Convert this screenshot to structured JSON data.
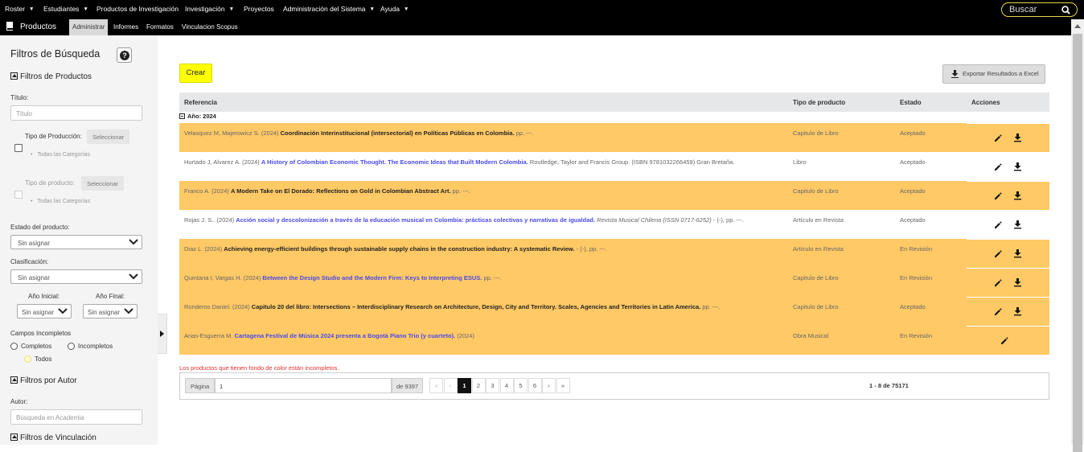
{
  "topnav": {
    "items": [
      {
        "label": "Roster",
        "caret": "▼"
      },
      {
        "label": "Estudiantes",
        "caret": "▼"
      },
      {
        "label": "Productos de Investigación",
        "caret": ""
      },
      {
        "label": "Investigación",
        "caret": "▼"
      },
      {
        "label": "Proyectos",
        "caret": ""
      },
      {
        "label": "Administración del Sistema",
        "caret": "▼"
      },
      {
        "label": "Ayuda",
        "caret": "▼"
      }
    ],
    "search_placeholder": "Buscar"
  },
  "subnav": {
    "brand": "Productos",
    "tabs": [
      "Administrar",
      "Informes",
      "Formatos",
      "Vinculacion Scopus"
    ]
  },
  "sidebar": {
    "title": "Filtros de Búsqueda",
    "help": "?",
    "section_productos": "Filtros de Productos",
    "titulo_label": "Título:",
    "titulo_placeholder": "Título",
    "tipo_produccion_label": "Tipo de Producción:",
    "tipo_produccion_btn": "Seleccionar",
    "tipo_produccion_all": "Todas las Categorías",
    "tipo_producto_label": "Tipo de producto:",
    "tipo_producto_btn": "Seleccionar",
    "tipo_producto_all": "Todas las Categorías",
    "estado_label": "Estado del producto:",
    "estado_value": "Sin asignar",
    "clasificacion_label": "Clasificación:",
    "clasificacion_value": "Sin asignar",
    "anio_inicial_label": "Año Inicial:",
    "anio_inicial_value": "Sin asignar",
    "anio_final_label": "Año Final:",
    "anio_final_value": "Sin asignar",
    "campos_label": "Campos Incompletos",
    "radio_completos": "Completos",
    "radio_incompletos": "Incompletos",
    "radio_todos": "Todos",
    "section_autor": "Filtros por Autor",
    "autor_label": "Autor:",
    "autor_placeholder": "Búsqueda en Academia",
    "section_vinculacion": "Filtros de Vinculación"
  },
  "main": {
    "crear": "Crear",
    "export": "Exportar Resultados a Excel",
    "columns": {
      "referencia": "Referencia",
      "tipo": "Tipo de producto",
      "estado": "Estado",
      "acciones": "Acciones"
    },
    "group_label": "Año: 2024",
    "rows": [
      {
        "authors": "Velasquez M, Majerowicz S. (2024) ",
        "title": "Coordinación Interinstitucional (intersectorial) en Políticas Públicas en Colombia.",
        "title_style": "bt",
        "rest": " pp. ---.",
        "journal": "",
        "tipo": "Capitulo de Libro",
        "estado": "Aceptado",
        "incomplete": true,
        "download": true
      },
      {
        "authors": "Hurtado J, Alvarez A. (2024) ",
        "title": "A History of Colombian Economic Thought. The Economic Ideas that Built Modern Colombia.",
        "title_style": "lk",
        "rest": " Routledge, Taylor and Francis Group. (ISBN 9781032266459) Gran Bretaña.",
        "journal": "",
        "tipo": "Libro",
        "estado": "Aceptado",
        "incomplete": false,
        "download": true
      },
      {
        "authors": "Franco A. (2024) ",
        "title": "A Modern Take on El Dorado: Reflections on Gold in Colombian Abstract Art.",
        "title_style": "bt",
        "rest": " pp. ---.",
        "journal": "",
        "tipo": "Capitulo de Libro",
        "estado": "Aceptado",
        "incomplete": true,
        "download": true
      },
      {
        "authors": "Rojas J. S.. (2024) ",
        "title": "Acción social y descolonización a través de la educación musical en Colombia: prácticas colectivas y narrativas de igualdad.",
        "title_style": "lk",
        "rest": " - (-), pp. ---.",
        "journal": " Revista Musical Chilena (ISSN 0717-6252)",
        "tipo": "Artículo en Revista",
        "estado": "Aceptado",
        "incomplete": false,
        "download": true
      },
      {
        "authors": "Diaz L. (2024) ",
        "title": "Achieving energy-efficient buildings through sustainable supply chains in the construction industry: A systematic Review.",
        "title_style": "bt",
        "rest": " - (-), pp. ---.",
        "journal": "",
        "tipo": "Artículo en Revista",
        "estado": "En Revisión",
        "incomplete": true,
        "download": true
      },
      {
        "authors": "Quintana I, Vargas H. (2024) ",
        "title": "Between the Design Studio and the Modern Firm: Keys to Interpreting ESUS.",
        "title_style": "lk",
        "rest": " pp. ---.",
        "journal": "",
        "tipo": "Capitulo de Libro",
        "estado": "En Revisión",
        "incomplete": true,
        "download": true
      },
      {
        "authors": "Ronderos Daniel. (2024) ",
        "title": "Capitulo 20 del libro: Intersections – Interdisciplinary Research on Architecture, Design, City and Territory. Scales, Agencies and Territories in Latin America.",
        "title_style": "bt",
        "rest": " pp. ---.",
        "journal": "",
        "tipo": "Capitulo de Libro",
        "estado": "Aceptado",
        "incomplete": true,
        "download": true
      },
      {
        "authors": "Arias-Esguerra M. ",
        "title": "Cartagena Festival de Música 2024 presenta a Bogotá Piano Trio (y cuarteto).",
        "title_style": "lk",
        "rest": " (2024)",
        "journal": "",
        "tipo": "Obra Musical",
        "estado": "En Revisión",
        "incomplete": true,
        "download": false
      }
    ],
    "note": "Los productos que tienen fondo de color están incompletos.",
    "pager": {
      "page_label": "Página",
      "page_value": "1",
      "of_label": "de 9397",
      "buttons": [
        "«",
        "‹",
        "1",
        "2",
        "3",
        "4",
        "5",
        "6",
        "›",
        "»"
      ],
      "current": "1",
      "count": "1 - 8 de 75171"
    }
  }
}
